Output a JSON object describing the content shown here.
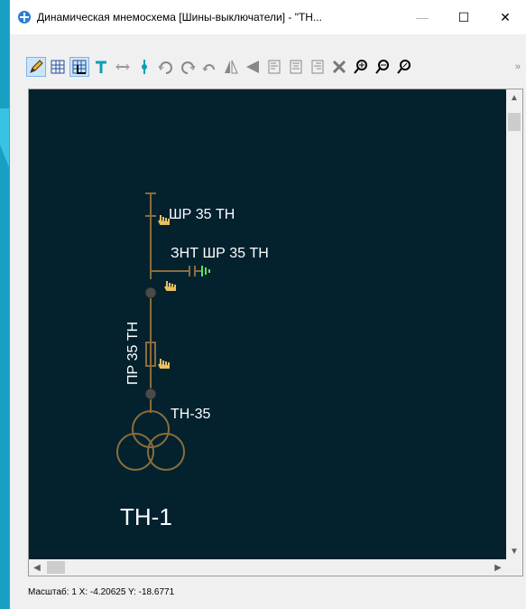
{
  "window": {
    "title": "Динамическая мнемосхема [Шины-выключатели] - \"ТН...",
    "minimize": "—",
    "maximize": "☐",
    "close": "✕"
  },
  "toolbar": {
    "icons": [
      "pencil-icon",
      "grid-icon",
      "snap-grid-icon",
      "branch-icon",
      "link-icon",
      "node-icon",
      "undo-turn-icon",
      "redo-turn-icon",
      "rotate-icon",
      "flip-vertical-icon",
      "flip-horizontal-icon",
      "align-left-icon",
      "align-center-icon",
      "align-right-icon",
      "delete-icon",
      "zoom-in-icon",
      "zoom-out-icon",
      "zoom-fit-icon"
    ],
    "more": "»"
  },
  "diagram": {
    "disconnector_label": "ШР 35 ТН",
    "grounding_label": "ЗНТ ШР 35 ТН",
    "fuse_label": "ПР 35 ТН",
    "transformer_label": "ТН-35",
    "title_label": "ТН-1",
    "colors": {
      "background": "#04212e",
      "line": "#8a6d3b",
      "ground": "#5fe05f",
      "text": "#ffffff"
    }
  },
  "scroll": {
    "up": "▲",
    "down": "▼",
    "left": "◀",
    "right": "▶"
  },
  "status": {
    "text": "Масштаб: 1  X: -4.20625 Y: -18.6771"
  }
}
